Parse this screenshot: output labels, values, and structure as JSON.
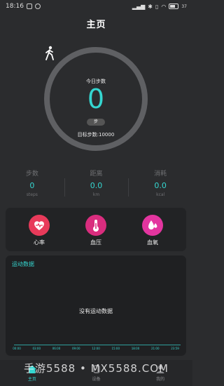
{
  "status_bar": {
    "time": "18:16",
    "battery": "37"
  },
  "header": {
    "title": "主页"
  },
  "ring": {
    "today_label": "今日步数",
    "steps": "0",
    "unit": "步",
    "goal_text": "目标步数:10000",
    "progress": 0
  },
  "stats": [
    {
      "label": "步数",
      "value": "0",
      "unit": "steps"
    },
    {
      "label": "距离",
      "value": "0.0",
      "unit": "km"
    },
    {
      "label": "消耗",
      "value": "0.0",
      "unit": "kcal"
    }
  ],
  "health": [
    {
      "label": "心率",
      "icon": "heart-rate-icon",
      "color": "#e83a5a"
    },
    {
      "label": "血压",
      "icon": "thermometer-icon",
      "color": "#d92d7e"
    },
    {
      "label": "血氧",
      "icon": "drops-icon",
      "color": "#e3359f"
    }
  ],
  "sport": {
    "title": "运动数据",
    "empty_text": "没有运动数据",
    "times": [
      "00:00",
      "03:00",
      "06:00",
      "09:00",
      "12:00",
      "15:00",
      "18:00",
      "21:00",
      "23:59"
    ]
  },
  "tabs": [
    {
      "label": "主页",
      "icon": "home-icon",
      "active": true
    },
    {
      "label": "设备",
      "icon": "device-icon",
      "active": false
    },
    {
      "label": "我的",
      "icon": "profile-icon",
      "active": false
    }
  ],
  "watermark": "手游5588 • MX5588.COM",
  "colors": {
    "accent": "#35d6d0",
    "background": "#2b2c2e",
    "card": "#1f2022"
  }
}
